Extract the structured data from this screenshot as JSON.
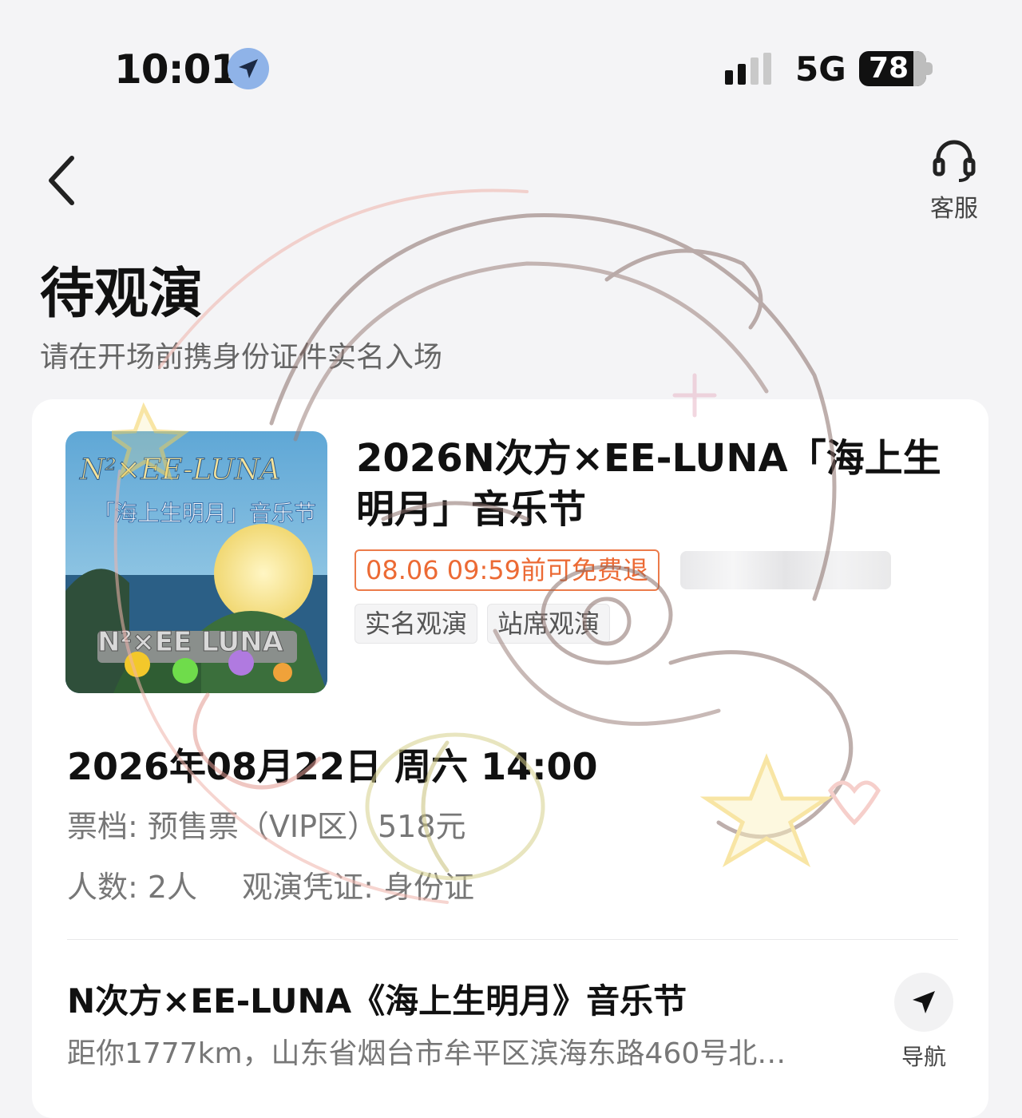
{
  "status_bar": {
    "time": "10:01",
    "network": "5G",
    "battery": "78"
  },
  "header": {
    "back_icon": "chevron-left-icon",
    "service_icon": "headset-icon",
    "service_label": "客服",
    "title": "待观演",
    "subtitle": "请在开场前携身份证件实名入场"
  },
  "order": {
    "poster": {
      "top_text": "N²×EE-LUNA",
      "main_text": "「海上生明月」音乐节",
      "bottom_text": "N²×EE LUNA"
    },
    "title": "2026N次方×EE-LUNA「海上生明月」音乐节",
    "refund_notice": "08.06 09:59前可免费退",
    "tags": [
      "实名观演",
      "站席观演"
    ],
    "datetime": "2026年08月22日 周六 14:00",
    "ticket_tier": "票档: 预售票（VIP区）518元",
    "people": "人数: 2人",
    "credential": "观演凭证: 身份证",
    "venue": "N次方×EE-LUNA《海上生明月》音乐节",
    "address": "距你1777km，山东省烟台市牟平区滨海东路460号北…",
    "nav_label": "导航",
    "nav_icon": "navigation-arrow-icon"
  },
  "colors": {
    "refund": "#ec6a34",
    "background": "#f4f4f6",
    "card": "#ffffff"
  }
}
